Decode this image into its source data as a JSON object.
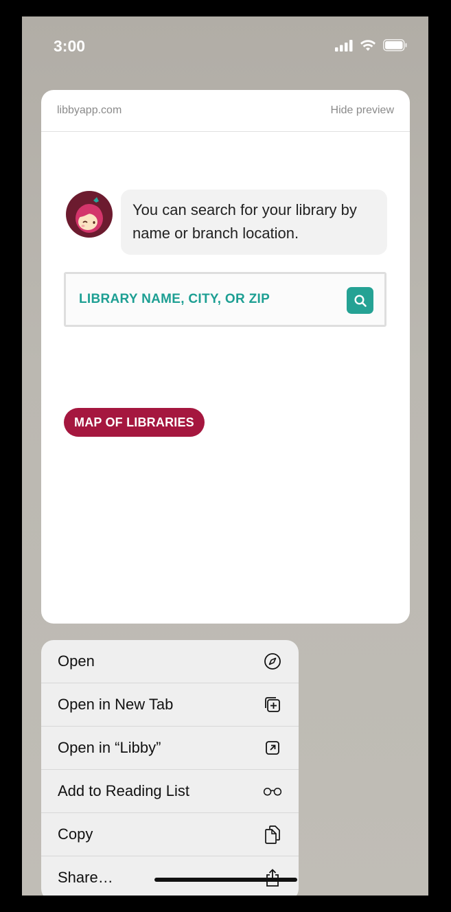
{
  "status_bar": {
    "time": "3:00"
  },
  "preview": {
    "domain": "libbyapp.com",
    "hide_label": "Hide preview",
    "message": "You can search for your library by name or branch location.",
    "search_placeholder": "LIBRARY NAME, CITY, OR ZIP",
    "map_button": "MAP OF LIBRARIES"
  },
  "menu": {
    "items": [
      {
        "label": "Open",
        "icon": "compass-icon"
      },
      {
        "label": "Open in New Tab",
        "icon": "new-tab-icon"
      },
      {
        "label": "Open in “Libby”",
        "icon": "open-app-icon"
      },
      {
        "label": "Add to Reading List",
        "icon": "glasses-icon"
      },
      {
        "label": "Copy",
        "icon": "copy-icon"
      },
      {
        "label": "Share…",
        "icon": "share-icon"
      }
    ]
  },
  "colors": {
    "accent_teal": "#25a294",
    "brand_red": "#a5173f",
    "avatar_bg": "#6c1b2f"
  }
}
